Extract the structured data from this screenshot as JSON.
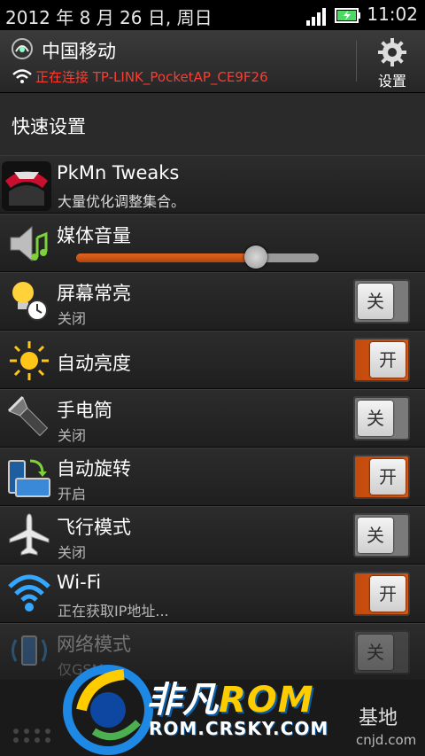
{
  "status_bar": {
    "date": "2012 年 8 月 26 日, 周日",
    "time": "11:02"
  },
  "notification": {
    "carrier": "中国移动",
    "connection_status": "正在连接 TP-LINK_PocketAP_CE9F26",
    "settings_label": "设置"
  },
  "quick_settings": {
    "title": "快速设置",
    "items": [
      {
        "title": "PkMn Tweaks",
        "subtitle": "大量优化调整集合。",
        "icon": "tweaks-icon"
      },
      {
        "title": "媒体音量",
        "icon": "speaker-music-icon",
        "volume_fraction": 0.74
      },
      {
        "title": "屏幕常亮",
        "subtitle": "关闭",
        "icon": "bulb-clock-icon",
        "toggle": "关",
        "state": "off"
      },
      {
        "title": "自动亮度",
        "icon": "sun-icon",
        "toggle": "开",
        "state": "on"
      },
      {
        "title": "手电筒",
        "subtitle": "关闭",
        "icon": "flashlight-icon",
        "toggle": "关",
        "state": "off"
      },
      {
        "title": "自动旋转",
        "subtitle": "开启",
        "icon": "rotate-icon",
        "toggle": "开",
        "state": "on"
      },
      {
        "title": "飞行模式",
        "subtitle": "关闭",
        "icon": "airplane-icon",
        "toggle": "关",
        "state": "off"
      },
      {
        "title": "Wi-Fi",
        "subtitle": "正在获取IP地址...",
        "icon": "wifi-icon",
        "toggle": "开",
        "state": "on"
      },
      {
        "title": "网络模式",
        "subtitle": "仅GSM",
        "icon": "network-mode-icon",
        "toggle": "关",
        "state": "disabled"
      }
    ]
  },
  "watermark": {
    "brand_main": "非凡",
    "brand_accent": "ROM",
    "url": "ROM.CRSKY.COM",
    "extra": "基地",
    "extra2": "cnjd.com"
  },
  "colors": {
    "accent": "#d65a16",
    "error_text": "#ff3b30",
    "background": "#151515"
  }
}
